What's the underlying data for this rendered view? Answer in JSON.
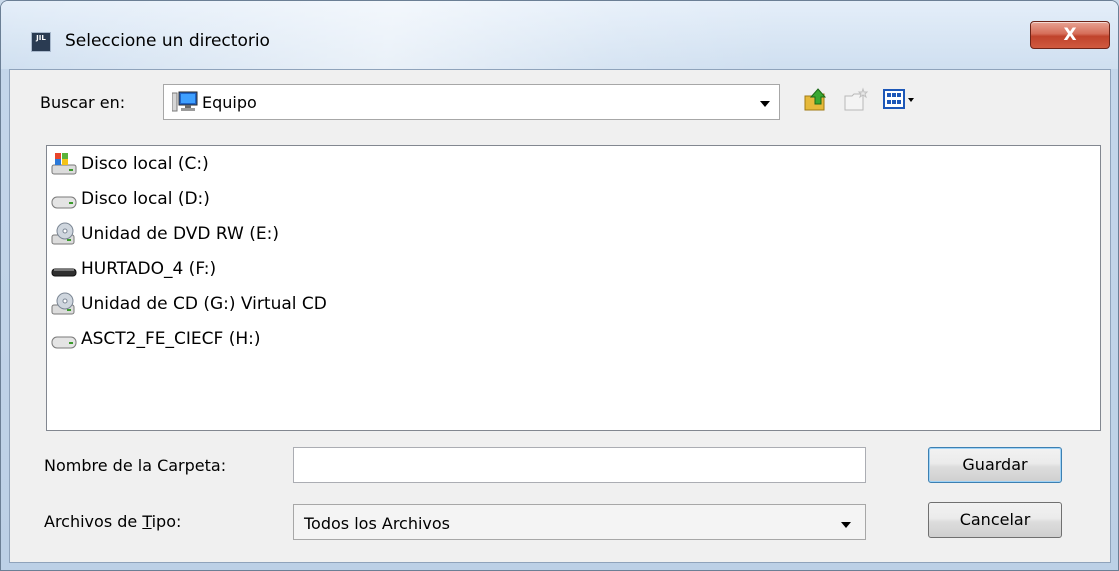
{
  "window": {
    "title": "Seleccione un directorio",
    "app_icon_text": "JIL",
    "close_glyph": "X"
  },
  "toolbar": {
    "look_in_label": "Buscar en:",
    "look_in_value": "Equipo",
    "icons": [
      "up-folder-icon",
      "new-folder-icon",
      "view-menu-icon"
    ]
  },
  "file_list": {
    "items": [
      {
        "label": "Disco local (C:)",
        "icon": "system-drive-icon"
      },
      {
        "label": "Disco local (D:)",
        "icon": "hard-drive-icon"
      },
      {
        "label": "Unidad de DVD RW (E:)",
        "icon": "dvd-drive-icon"
      },
      {
        "label": "HURTADO_4 (F:)",
        "icon": "removable-drive-icon"
      },
      {
        "label": "Unidad de CD (G:) Virtual CD",
        "icon": "cd-drive-icon"
      },
      {
        "label": "ASCT2_FE_CIECF (H:)",
        "icon": "hard-drive-icon"
      }
    ]
  },
  "folder_name": {
    "label": "Nombre de la Carpeta:",
    "value": ""
  },
  "file_type": {
    "label_prefix": "Archivos de ",
    "label_mnemonic": "T",
    "label_suffix": "ipo:",
    "value": "Todos los Archivos"
  },
  "buttons": {
    "save": "Guardar",
    "cancel": "Cancelar"
  },
  "colors": {
    "close_button": "#c0432c",
    "titlebar": "#cfdff0",
    "dialog_background": "#f0f0f0"
  }
}
